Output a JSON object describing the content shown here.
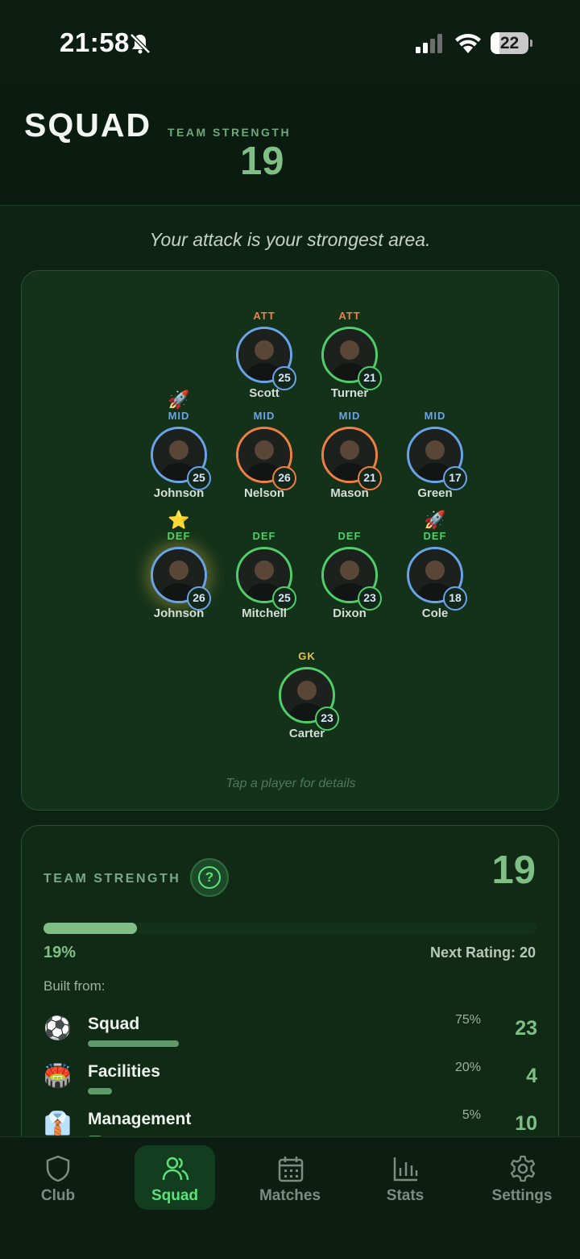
{
  "status": {
    "time": "21:58",
    "battery": "22"
  },
  "header": {
    "title": "SQUAD",
    "strength_label": "TEAM STRENGTH",
    "strength_value": "19"
  },
  "subtitle": "Your attack is your strongest area.",
  "pitch": {
    "hint": "Tap a player for details",
    "players": [
      {
        "pos": "ATT",
        "name": "Scott",
        "rating": "25",
        "color": "#6ba3e8",
        "pos_color": "#f07f45",
        "badge": ""
      },
      {
        "pos": "ATT",
        "name": "Turner",
        "rating": "21",
        "color": "#4fcf6a",
        "pos_color": "#f07f45",
        "badge": ""
      },
      {
        "pos": "MID",
        "name": "Johnson",
        "rating": "25",
        "color": "#6ba3e8",
        "pos_color": "#6ba3e8",
        "badge": "🚀"
      },
      {
        "pos": "MID",
        "name": "Nelson",
        "rating": "26",
        "color": "#f07f45",
        "pos_color": "#6ba3e8",
        "badge": ""
      },
      {
        "pos": "MID",
        "name": "Mason",
        "rating": "21",
        "color": "#f07f45",
        "pos_color": "#6ba3e8",
        "badge": ""
      },
      {
        "pos": "MID",
        "name": "Green",
        "rating": "17",
        "color": "#6ba3e8",
        "pos_color": "#6ba3e8",
        "badge": ""
      },
      {
        "pos": "DEF",
        "name": "Johnson",
        "rating": "26",
        "color": "#6ba3e8",
        "pos_color": "#4fcf6a",
        "badge": "⭐"
      },
      {
        "pos": "DEF",
        "name": "Mitchell",
        "rating": "25",
        "color": "#4fcf6a",
        "pos_color": "#4fcf6a",
        "badge": ""
      },
      {
        "pos": "DEF",
        "name": "Dixon",
        "rating": "23",
        "color": "#4fcf6a",
        "pos_color": "#4fcf6a",
        "badge": ""
      },
      {
        "pos": "DEF",
        "name": "Cole",
        "rating": "18",
        "color": "#6ba3e8",
        "pos_color": "#4fcf6a",
        "badge": "🚀"
      },
      {
        "pos": "GK",
        "name": "Carter",
        "rating": "23",
        "color": "#4fcf6a",
        "pos_color": "#e8c24a",
        "badge": ""
      }
    ]
  },
  "strength_card": {
    "label": "TEAM STRENGTH",
    "value": "19",
    "progress": 0.19,
    "progress_text": "19%",
    "next_rating": "Next Rating: 20",
    "built_from": "Built from:",
    "components": [
      {
        "icon": "⚽",
        "name": "Squad",
        "pct": "75%",
        "value": "23",
        "fill": 0.75
      },
      {
        "icon": "🏟️",
        "name": "Facilities",
        "pct": "20%",
        "value": "4",
        "fill": 0.2
      },
      {
        "icon": "👔",
        "name": "Management",
        "pct": "5%",
        "value": "10",
        "fill": 0.05
      }
    ]
  },
  "nav": {
    "items": [
      {
        "label": "Club",
        "icon": "shield-icon"
      },
      {
        "label": "Squad",
        "icon": "users-icon"
      },
      {
        "label": "Matches",
        "icon": "calendar-icon"
      },
      {
        "label": "Stats",
        "icon": "bar-chart-icon"
      },
      {
        "label": "Settings",
        "icon": "gear-icon"
      }
    ],
    "active": "Squad"
  }
}
